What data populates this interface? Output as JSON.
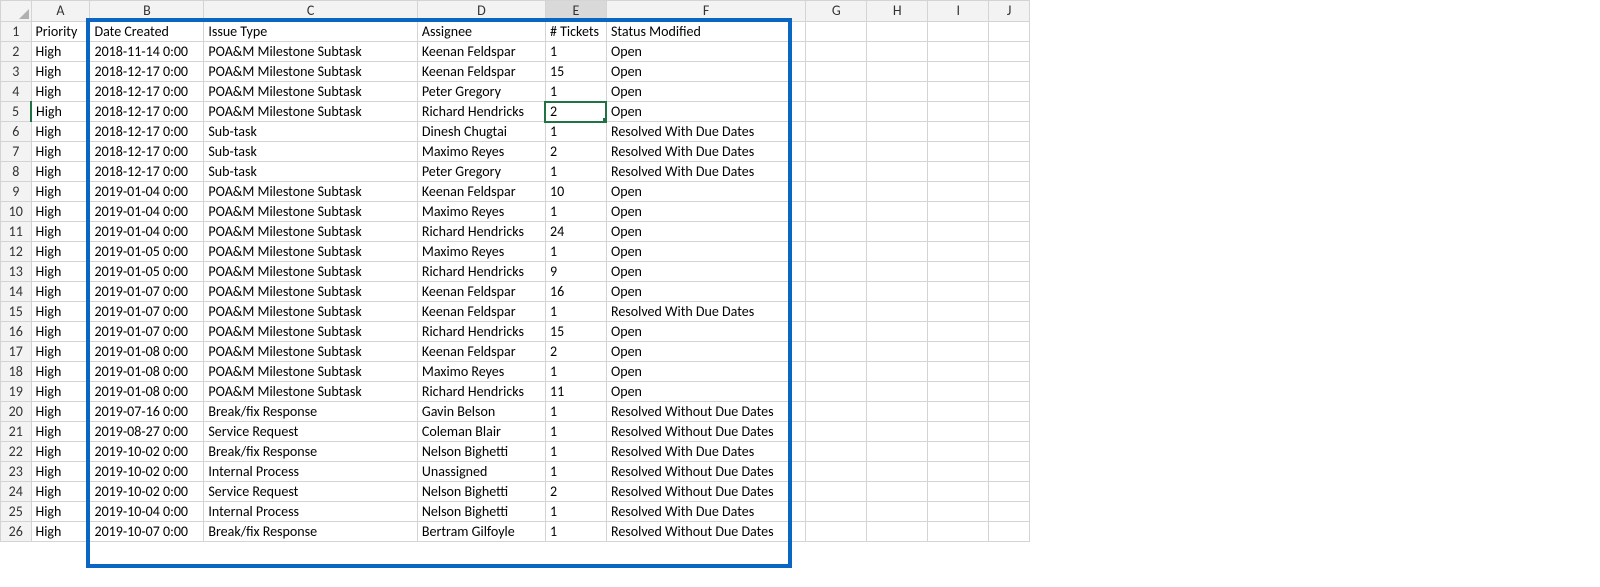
{
  "columns": [
    "A",
    "B",
    "C",
    "D",
    "E",
    "F",
    "G",
    "H",
    "I",
    "J"
  ],
  "headers": {
    "A": "Priority",
    "B": "Date Created",
    "C": "Issue Type",
    "D": "Assignee",
    "E": "# Tickets",
    "F": "Status Modified"
  },
  "active_cell": "E5",
  "highlight_range": "B1:F26",
  "rows": [
    {
      "n": 2,
      "priority": "High",
      "date": "2018-11-14 0:00",
      "type": "POA&M Milestone Subtask",
      "assignee": "Keenan Feldspar",
      "tickets": 1,
      "status": "Open"
    },
    {
      "n": 3,
      "priority": "High",
      "date": "2018-12-17 0:00",
      "type": "POA&M Milestone Subtask",
      "assignee": "Keenan Feldspar",
      "tickets": 15,
      "status": "Open"
    },
    {
      "n": 4,
      "priority": "High",
      "date": "2018-12-17 0:00",
      "type": "POA&M Milestone Subtask",
      "assignee": "Peter Gregory",
      "tickets": 1,
      "status": "Open"
    },
    {
      "n": 5,
      "priority": "High",
      "date": "2018-12-17 0:00",
      "type": "POA&M Milestone Subtask",
      "assignee": "Richard Hendricks",
      "tickets": 2,
      "status": "Open"
    },
    {
      "n": 6,
      "priority": "High",
      "date": "2018-12-17 0:00",
      "type": "Sub-task",
      "assignee": "Dinesh Chugtai",
      "tickets": 1,
      "status": "Resolved With Due Dates"
    },
    {
      "n": 7,
      "priority": "High",
      "date": "2018-12-17 0:00",
      "type": "Sub-task",
      "assignee": "Maximo Reyes",
      "tickets": 2,
      "status": "Resolved With Due Dates"
    },
    {
      "n": 8,
      "priority": "High",
      "date": "2018-12-17 0:00",
      "type": "Sub-task",
      "assignee": "Peter Gregory",
      "tickets": 1,
      "status": "Resolved With Due Dates"
    },
    {
      "n": 9,
      "priority": "High",
      "date": "2019-01-04 0:00",
      "type": "POA&M Milestone Subtask",
      "assignee": "Keenan Feldspar",
      "tickets": 10,
      "status": "Open"
    },
    {
      "n": 10,
      "priority": "High",
      "date": "2019-01-04 0:00",
      "type": "POA&M Milestone Subtask",
      "assignee": "Maximo Reyes",
      "tickets": 1,
      "status": "Open"
    },
    {
      "n": 11,
      "priority": "High",
      "date": "2019-01-04 0:00",
      "type": "POA&M Milestone Subtask",
      "assignee": "Richard Hendricks",
      "tickets": 24,
      "status": "Open"
    },
    {
      "n": 12,
      "priority": "High",
      "date": "2019-01-05 0:00",
      "type": "POA&M Milestone Subtask",
      "assignee": "Maximo Reyes",
      "tickets": 1,
      "status": "Open"
    },
    {
      "n": 13,
      "priority": "High",
      "date": "2019-01-05 0:00",
      "type": "POA&M Milestone Subtask",
      "assignee": "Richard Hendricks",
      "tickets": 9,
      "status": "Open"
    },
    {
      "n": 14,
      "priority": "High",
      "date": "2019-01-07 0:00",
      "type": "POA&M Milestone Subtask",
      "assignee": "Keenan Feldspar",
      "tickets": 16,
      "status": "Open"
    },
    {
      "n": 15,
      "priority": "High",
      "date": "2019-01-07 0:00",
      "type": "POA&M Milestone Subtask",
      "assignee": "Keenan Feldspar",
      "tickets": 1,
      "status": "Resolved With Due Dates"
    },
    {
      "n": 16,
      "priority": "High",
      "date": "2019-01-07 0:00",
      "type": "POA&M Milestone Subtask",
      "assignee": "Richard Hendricks",
      "tickets": 15,
      "status": "Open"
    },
    {
      "n": 17,
      "priority": "High",
      "date": "2019-01-08 0:00",
      "type": "POA&M Milestone Subtask",
      "assignee": "Keenan Feldspar",
      "tickets": 2,
      "status": "Open"
    },
    {
      "n": 18,
      "priority": "High",
      "date": "2019-01-08 0:00",
      "type": "POA&M Milestone Subtask",
      "assignee": "Maximo Reyes",
      "tickets": 1,
      "status": "Open"
    },
    {
      "n": 19,
      "priority": "High",
      "date": "2019-01-08 0:00",
      "type": "POA&M Milestone Subtask",
      "assignee": "Richard Hendricks",
      "tickets": 11,
      "status": "Open"
    },
    {
      "n": 20,
      "priority": "High",
      "date": "2019-07-16 0:00",
      "type": "Break/fix Response",
      "assignee": "Gavin Belson",
      "tickets": 1,
      "status": "Resolved Without Due Dates"
    },
    {
      "n": 21,
      "priority": "High",
      "date": "2019-08-27 0:00",
      "type": "Service Request",
      "assignee": "Coleman Blair",
      "tickets": 1,
      "status": "Resolved Without Due Dates"
    },
    {
      "n": 22,
      "priority": "High",
      "date": "2019-10-02 0:00",
      "type": "Break/fix Response",
      "assignee": "Nelson Bighetti",
      "tickets": 1,
      "status": "Resolved With Due Dates"
    },
    {
      "n": 23,
      "priority": "High",
      "date": "2019-10-02 0:00",
      "type": "Internal Process",
      "assignee": "Unassigned",
      "tickets": 1,
      "status": "Resolved Without Due Dates"
    },
    {
      "n": 24,
      "priority": "High",
      "date": "2019-10-02 0:00",
      "type": "Service Request",
      "assignee": "Nelson Bighetti",
      "tickets": 2,
      "status": "Resolved Without Due Dates"
    },
    {
      "n": 25,
      "priority": "High",
      "date": "2019-10-04 0:00",
      "type": "Internal Process",
      "assignee": "Nelson Bighetti",
      "tickets": 1,
      "status": "Resolved With Due Dates"
    },
    {
      "n": 26,
      "priority": "High",
      "date": "2019-10-07 0:00",
      "type": "Break/fix Response",
      "assignee": "Bertram Gilfoyle",
      "tickets": 1,
      "status": "Resolved Without Due Dates"
    }
  ]
}
